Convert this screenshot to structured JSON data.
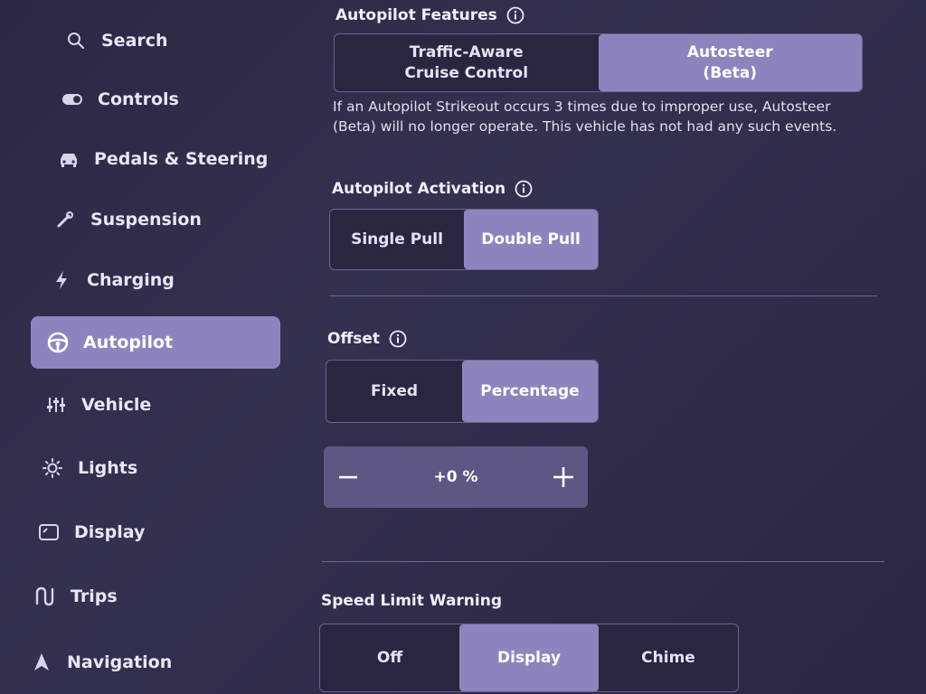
{
  "sidebar": {
    "items": [
      {
        "label": "Search",
        "icon": "search-icon"
      },
      {
        "label": "Controls",
        "icon": "toggle-icon"
      },
      {
        "label": "Pedals & Steering",
        "icon": "car-icon"
      },
      {
        "label": "Suspension",
        "icon": "wrench-icon"
      },
      {
        "label": "Charging",
        "icon": "bolt-icon"
      },
      {
        "label": "Autopilot",
        "icon": "steering-wheel-icon",
        "active": true
      },
      {
        "label": "Vehicle",
        "icon": "sliders-icon"
      },
      {
        "label": "Lights",
        "icon": "sun-icon"
      },
      {
        "label": "Display",
        "icon": "display-icon"
      },
      {
        "label": "Trips",
        "icon": "route-icon"
      },
      {
        "label": "Navigation",
        "icon": "navigation-arrow-icon"
      }
    ]
  },
  "autopilot_features": {
    "title": "Autopilot Features",
    "options": [
      "Traffic-Aware\nCruise Control",
      "Autosteer\n(Beta)"
    ],
    "selected": "Autosteer\n(Beta)",
    "note": "If an Autopilot Strikeout occurs 3 times due to improper use, Autosteer (Beta) will no longer operate. This vehicle has not had any such events."
  },
  "autopilot_activation": {
    "title": "Autopilot Activation",
    "options": [
      "Single Pull",
      "Double Pull"
    ],
    "selected": "Double Pull"
  },
  "offset": {
    "title": "Offset",
    "options": [
      "Fixed",
      "Percentage"
    ],
    "selected": "Percentage",
    "value": "+0 %"
  },
  "speed_limit_warning": {
    "title": "Speed Limit Warning",
    "options": [
      "Off",
      "Display",
      "Chime"
    ],
    "selected": "Display"
  },
  "colors": {
    "accent": "#8e84bd",
    "background": "#2f2a47"
  }
}
